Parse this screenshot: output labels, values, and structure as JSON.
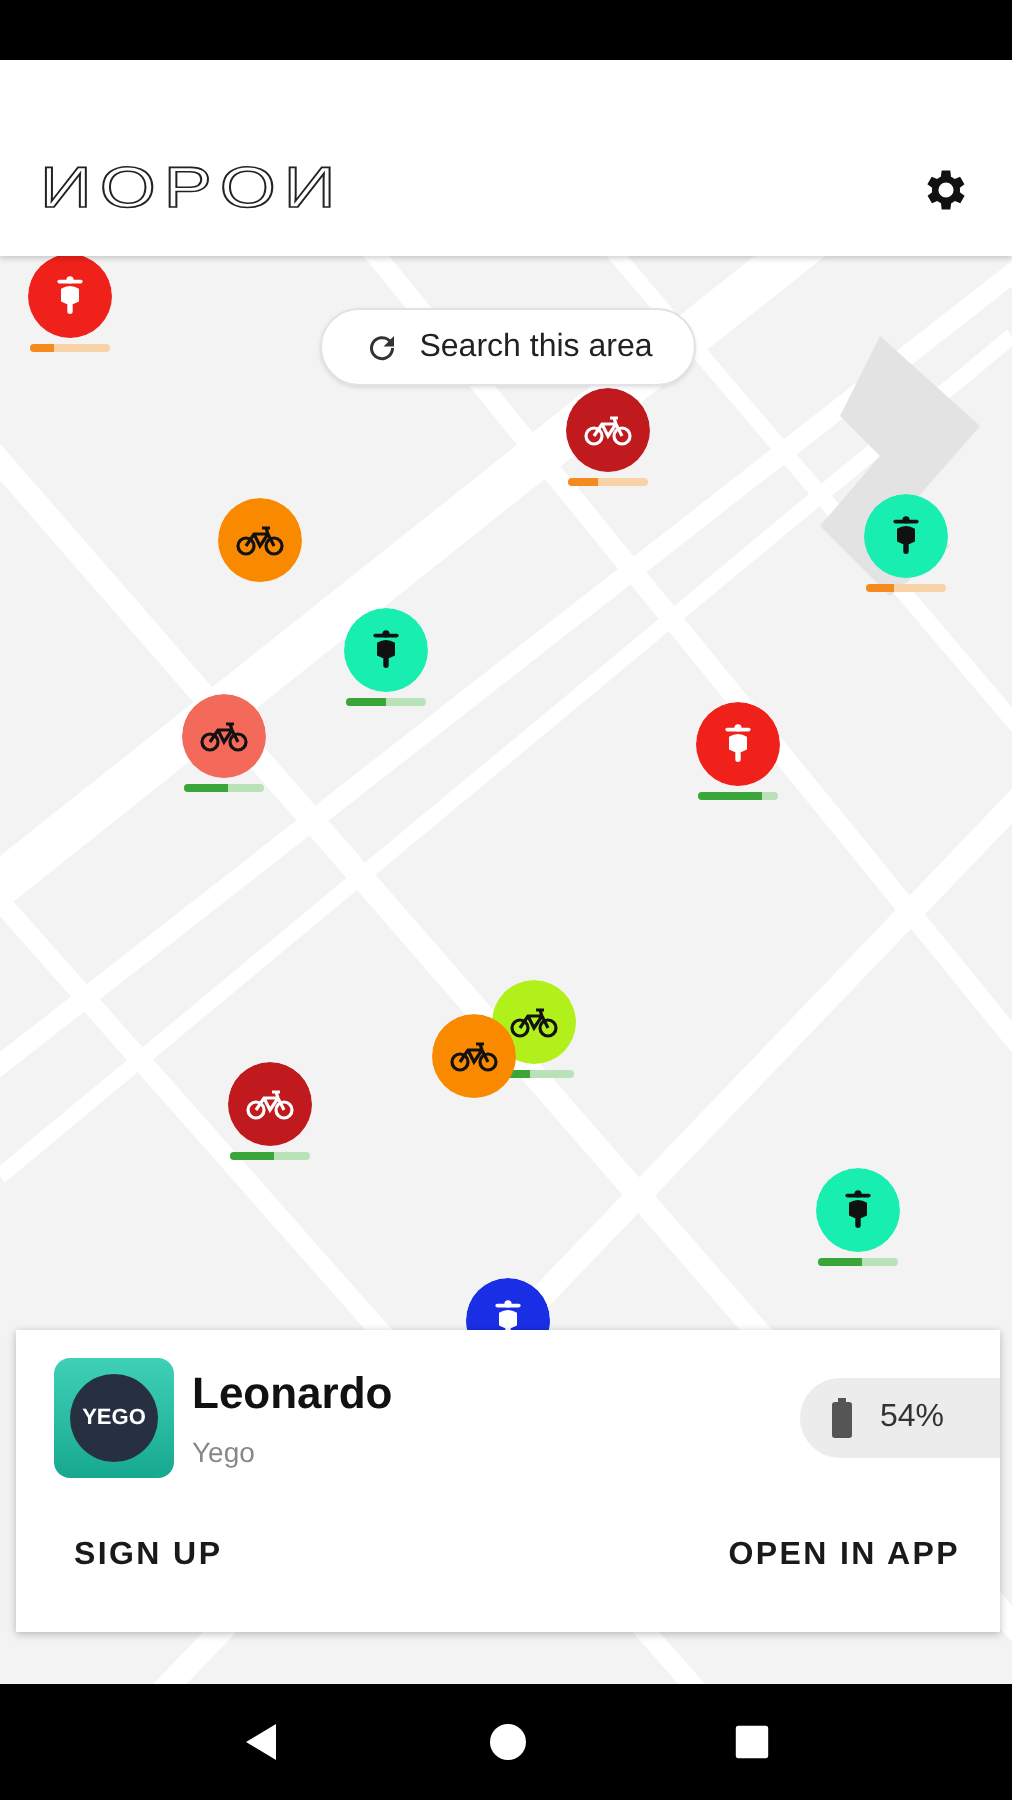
{
  "header": {
    "logo": "ИOPOИ"
  },
  "map": {
    "kind": "picture",
    "search_button": "Search this area",
    "markers": [
      {
        "kind": "scooter",
        "color": "#f0201a",
        "level": 0.3
      },
      {
        "kind": "bike",
        "color": "#c0191e",
        "level": 0.38
      },
      {
        "kind": "bike",
        "color": "#f98a00"
      },
      {
        "kind": "scooter",
        "color": "#17eeb0",
        "level": 0.35
      },
      {
        "kind": "scooter",
        "color": "#17eeb0",
        "level": 0.5
      },
      {
        "kind": "bike",
        "color": "#f46a5a",
        "level": 0.55
      },
      {
        "kind": "scooter",
        "color": "#f0201a",
        "level": 0.8
      },
      {
        "kind": "bike",
        "color": "#b2f01c",
        "level": 0.45
      },
      {
        "kind": "bike",
        "color": "#f98a00"
      },
      {
        "kind": "bike",
        "color": "#c0191e",
        "level": 0.55
      },
      {
        "kind": "scooter",
        "color": "#17eeb0",
        "level": 0.55
      },
      {
        "kind": "scooter",
        "color": "#1a2ee6"
      }
    ]
  },
  "card": {
    "app_icon": "YEGO",
    "title": "Leonardo",
    "subtitle": "Yego",
    "battery": "54%",
    "buttons": [
      "SIGN UP",
      "OPEN IN APP"
    ]
  }
}
